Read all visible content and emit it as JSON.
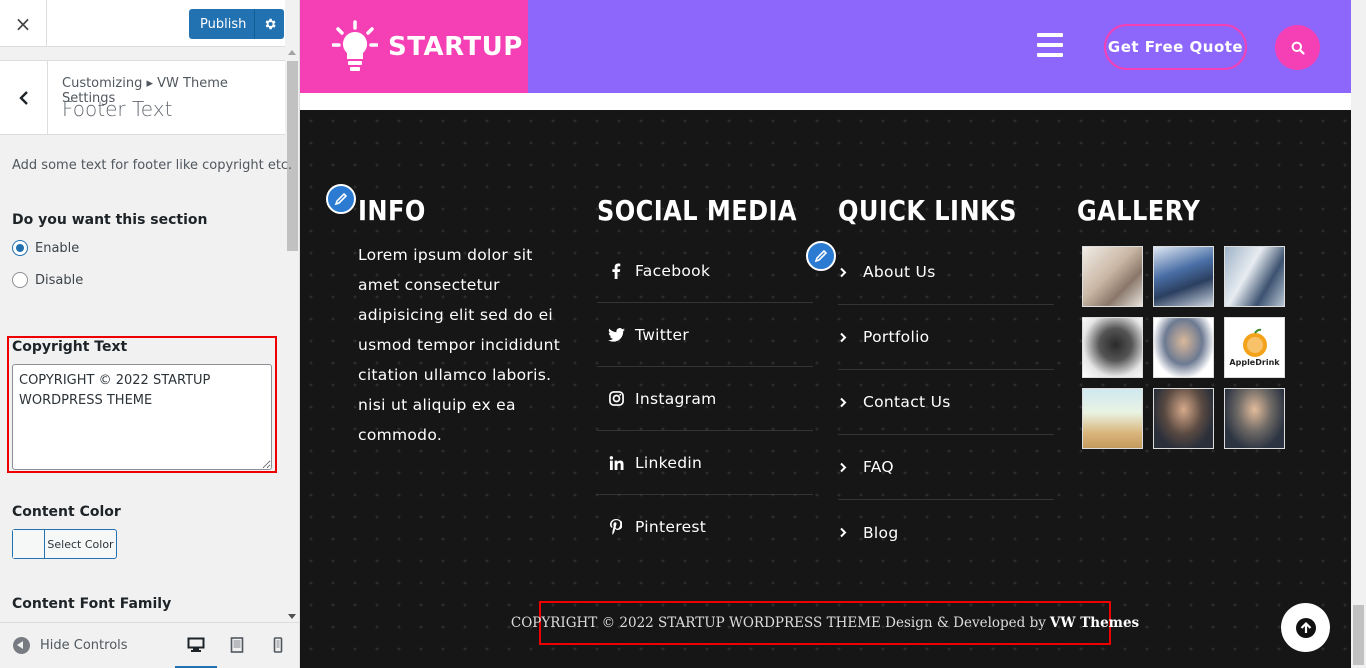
{
  "customizer": {
    "close_label": "×",
    "publish_label": "Publish",
    "breadcrumb": "Customizing ▸ VW Theme Settings",
    "section_title": "Footer Text",
    "description": "Add some text for footer like copyright etc.",
    "show_section_label": "Do you want this section",
    "radio_options": [
      "Enable",
      "Disable"
    ],
    "radio_selected": "Enable",
    "copyright_label": "Copyright Text",
    "copyright_value": "COPYRIGHT © 2022 STARTUP WORDPRESS THEME",
    "content_color_label": "Content Color",
    "select_color_label": "Select Color",
    "font_family_label": "Content Font Family",
    "hide_controls_label": "Hide Controls",
    "active_device": "desktop"
  },
  "site": {
    "logo_text": "STARTUP",
    "quote_label": "Get Free Quote",
    "colors": {
      "header": "#8d67fb",
      "accent": "#f43fb5",
      "footer": "#161616"
    },
    "info": {
      "title": "INFO",
      "text": "Lorem ipsum dolor sit amet consectetur adipisicing elit sed do ei usmod tempor incididunt citation ullamco laboris. nisi ut aliquip ex ea commodo."
    },
    "social": {
      "title": "SOCIAL MEDIA",
      "items": [
        {
          "label": "Facebook",
          "icon": "facebook-icon"
        },
        {
          "label": "Twitter",
          "icon": "twitter-icon"
        },
        {
          "label": "Instagram",
          "icon": "instagram-icon"
        },
        {
          "label": "Linkedin",
          "icon": "linkedin-icon"
        },
        {
          "label": "Pinterest",
          "icon": "pinterest-icon"
        }
      ]
    },
    "quick_links": {
      "title": "QUICK LINKS",
      "items": [
        "About Us",
        "Portfolio",
        "Contact Us",
        "FAQ",
        "Blog"
      ]
    },
    "gallery": {
      "title": "GALLERY",
      "thumb_logo_text": "AppleDrink"
    },
    "copyright": {
      "text": "COPYRIGHT © 2022 STARTUP WORDPRESS THEME Design & Developed by",
      "link": "VW Themes"
    }
  }
}
